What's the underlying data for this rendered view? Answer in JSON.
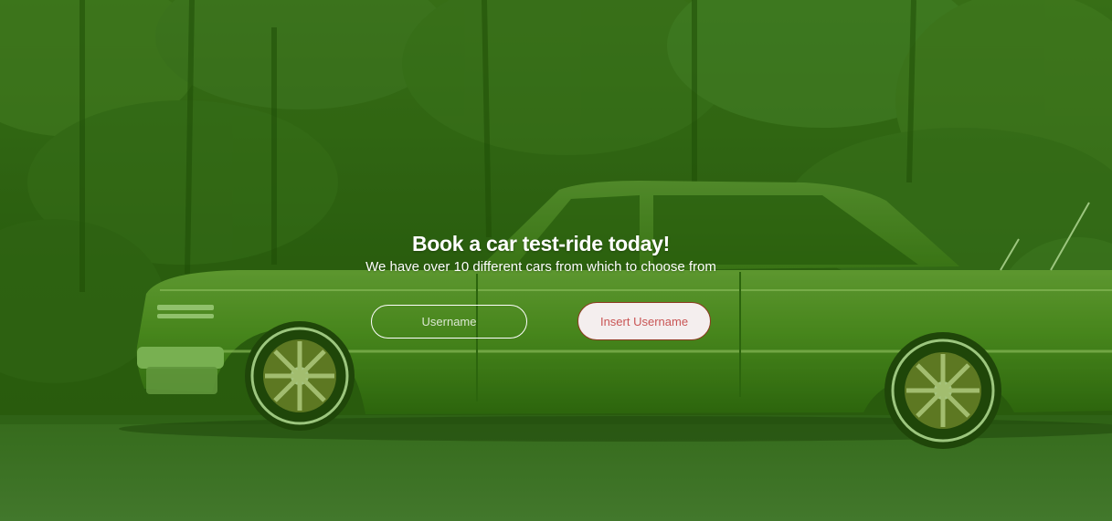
{
  "hero": {
    "title": "Book a car test-ride today!",
    "subtitle": "We have over 10 different cars from which to choose from",
    "overlay_color": "#2f6a12"
  },
  "form": {
    "username_placeholder": "Username",
    "username_value": "",
    "submit_label": "Insert Username",
    "submit_text_color": "#c95555",
    "submit_border_color": "#8b3a1f"
  },
  "background": {
    "image_subject": "green-classic-car-in-forest"
  }
}
